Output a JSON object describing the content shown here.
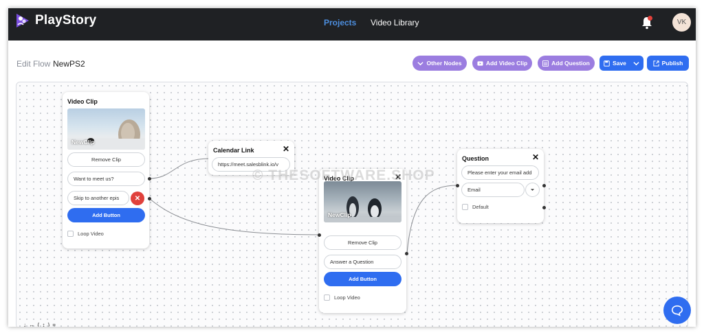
{
  "app": {
    "name": "PlayStory"
  },
  "nav": {
    "projects": "Projects",
    "video_library": "Video Library"
  },
  "user": {
    "initials": "VK"
  },
  "flow": {
    "edit_label": "Edit Flow",
    "name": "NewPS2"
  },
  "toolbar": {
    "other_nodes": "Other Nodes",
    "add_video_clip": "Add Video Clip",
    "add_question": "Add Question",
    "save": "Save",
    "publish": "Publish"
  },
  "nodes": {
    "video1": {
      "title": "Video Clip",
      "clip_name": "NewClip",
      "remove_clip": "Remove Clip",
      "button1": "Want to meet us?",
      "button2": "Skip to another epis",
      "add_button": "Add Button",
      "loop_video": "Loop Video"
    },
    "calendar": {
      "title": "Calendar Link",
      "url": "https://meet.salesblink.io/v"
    },
    "video2": {
      "title": "Video Clip",
      "clip_name": "NewClip",
      "remove_clip": "Remove Clip",
      "answer": "Answer a Question",
      "add_button": "Add Button",
      "loop_video": "Loop Video"
    },
    "question": {
      "title": "Question",
      "placeholder": "Please enter your email add",
      "type": "Email",
      "default_label": "Default"
    }
  },
  "watermark": "© THESOFTWARE.SHOP",
  "corner_text": "↓ ↔ { ↕ }  ⌗",
  "colors": {
    "accent_blue": "#2f6df0",
    "accent_purple": "#9b7de0",
    "topbar": "#1f2124",
    "delete_red": "#e0413c"
  }
}
